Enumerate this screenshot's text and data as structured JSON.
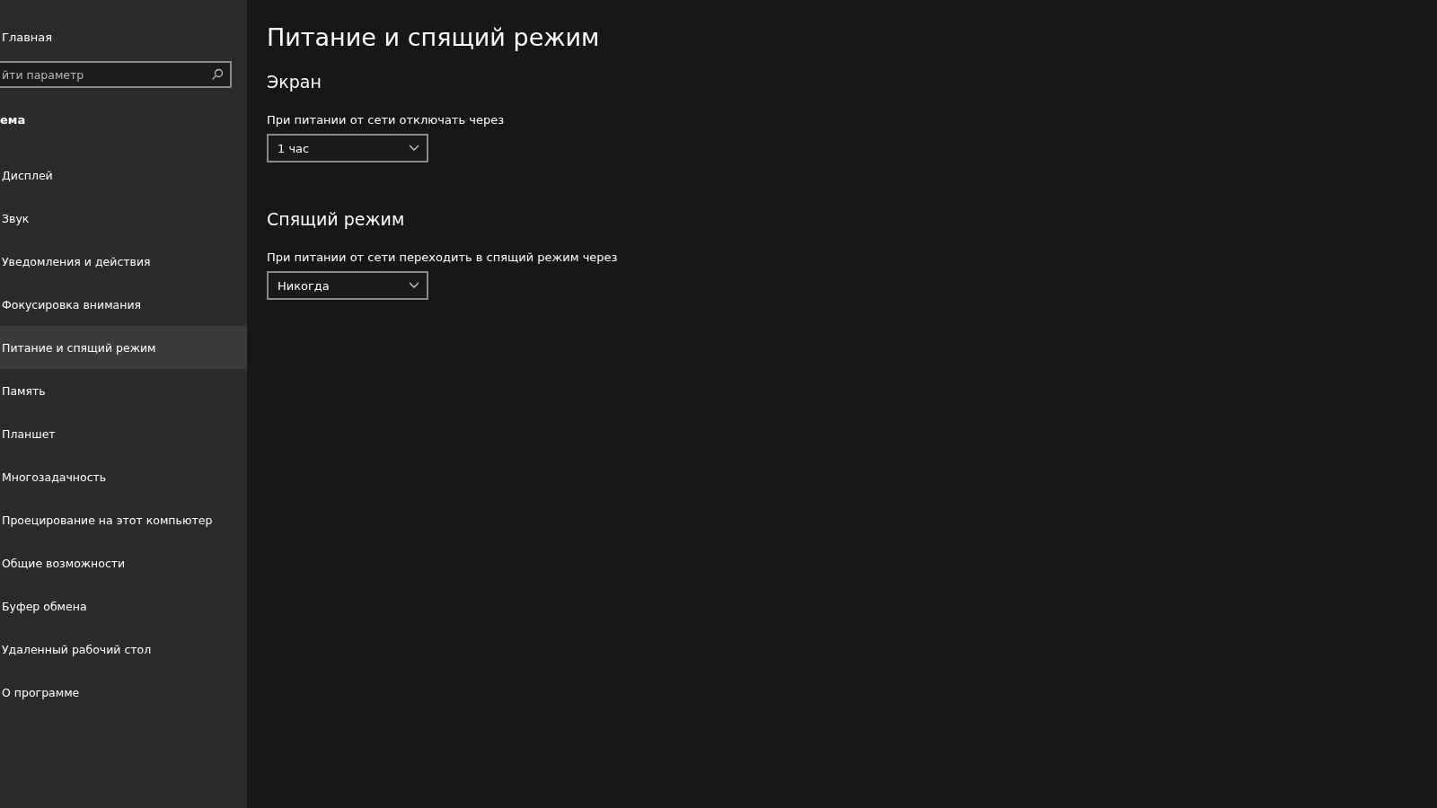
{
  "sidebar": {
    "home": "Главная",
    "search": {
      "placeholder": "йти параметр"
    },
    "section": "ема",
    "items": [
      {
        "label": "Дисплей",
        "selected": false
      },
      {
        "label": "Звук",
        "selected": false
      },
      {
        "label": "Уведомления и действия",
        "selected": false
      },
      {
        "label": "Фокусировка внимания",
        "selected": false
      },
      {
        "label": "Питание и спящий режим",
        "selected": true
      },
      {
        "label": "Память",
        "selected": false
      },
      {
        "label": "Планшет",
        "selected": false
      },
      {
        "label": "Многозадачность",
        "selected": false
      },
      {
        "label": "Проецирование на этот компьютер",
        "selected": false
      },
      {
        "label": "Общие возможности",
        "selected": false
      },
      {
        "label": "Буфер обмена",
        "selected": false
      },
      {
        "label": "Удаленный рабочий стол",
        "selected": false
      },
      {
        "label": "О программе",
        "selected": false
      }
    ]
  },
  "page": {
    "title": "Питание и спящий режим",
    "sections": [
      {
        "heading": "Экран",
        "label": "При питании от сети отключать через",
        "value": "1 час"
      },
      {
        "heading": "Спящий режим",
        "label": "При питании от сети переходить в спящий режим через",
        "value": "Никогда"
      }
    ]
  }
}
